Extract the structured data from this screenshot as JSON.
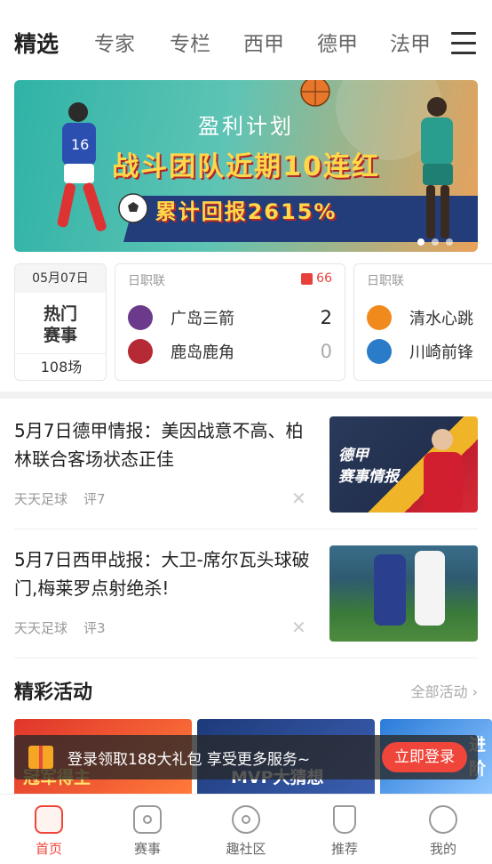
{
  "topnav": {
    "tabs": [
      "精选",
      "专家",
      "专栏",
      "西甲",
      "德甲",
      "法甲"
    ],
    "active_index": 0
  },
  "banner": {
    "line1": "盈利计划",
    "line2": "战斗团队近期10连红",
    "line3": "累计回报2615%",
    "active_dot": 0
  },
  "matches": {
    "hot": {
      "date": "05月07日",
      "label_line1": "热门",
      "label_line2": "赛事",
      "count": "108场"
    },
    "cards": [
      {
        "league": "日职联",
        "hot_count": "66",
        "home": {
          "name": "广岛三箭",
          "score": "2",
          "color": "#6b3a8a"
        },
        "away": {
          "name": "鹿岛鹿角",
          "score": "0",
          "color": "#b52a35"
        }
      },
      {
        "league": "日职联",
        "home": {
          "name": "清水心跳",
          "color": "#f08a1c"
        },
        "away": {
          "name": "川崎前锋",
          "color": "#2a7bc8"
        }
      }
    ]
  },
  "news": [
    {
      "title": "5月7日德甲情报：美因战意不高、柏林联合客场状态正佳",
      "source": "天天足球",
      "comments": "评7",
      "thumb_text_line1": "德甲",
      "thumb_text_line2": "赛事情报"
    },
    {
      "title": "5月7日西甲战报：大卫-席尔瓦头球破门,梅莱罗点射绝杀!",
      "source": "天天足球",
      "comments": "评3"
    }
  ],
  "activities": {
    "title": "精彩活动",
    "more": "全部活动",
    "cards": [
      {
        "text": "冠军得主"
      },
      {
        "text": "MVP大猜想"
      },
      {
        "text": "进阶"
      }
    ]
  },
  "login_bar": {
    "text": "登录领取188大礼包 享受更多服务~",
    "button": "立即登录"
  },
  "bottomnav": {
    "items": [
      "首页",
      "赛事",
      "趣社区",
      "推荐",
      "我的"
    ],
    "active_index": 0
  },
  "colors": {
    "accent": "#f0453a",
    "hot": "#e8413c"
  }
}
